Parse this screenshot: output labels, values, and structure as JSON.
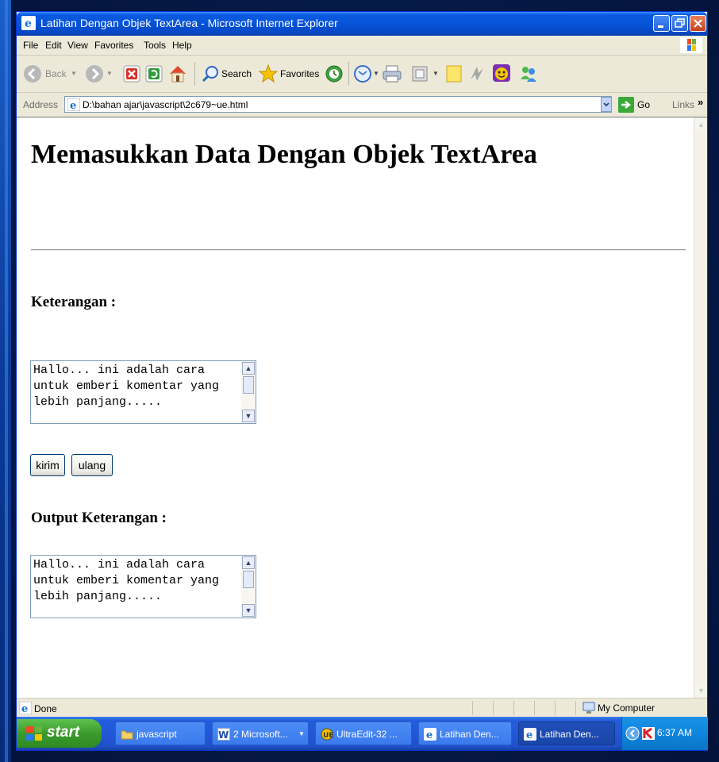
{
  "window": {
    "title": "Latihan Dengan Objek TextArea - Microsoft Internet Explorer"
  },
  "menu": [
    "File",
    "Edit",
    "View",
    "Favorites",
    "Tools",
    "Help"
  ],
  "toolbar": {
    "back_label": "Back",
    "search_label": "Search",
    "favorites_label": "Favorites"
  },
  "address": {
    "label": "Address",
    "url": "D:\\bahan ajar\\javascript\\2c679~ue.html",
    "go_label": "Go",
    "links_label": "Links"
  },
  "page": {
    "heading": "Memasukkan Data Dengan Objek TextArea",
    "keterangan_label": "Keterangan :",
    "input_text": "Hallo... ini adalah cara\nuntuk emberi komentar yang\nlebih panjang.....",
    "submit_label": "kirim",
    "reset_label": "ulang",
    "output_label": "Output Keterangan :",
    "output_text": "Hallo... ini adalah cara\nuntuk emberi komentar yang\nlebih panjang....."
  },
  "status": {
    "text": "Done",
    "zone": "My Computer"
  },
  "taskbar": {
    "start_label": "start",
    "tasks": [
      {
        "label": "javascript"
      },
      {
        "label": "2 Microsoft..."
      },
      {
        "label": "UltraEdit-32 ..."
      },
      {
        "label": "Latihan Den..."
      },
      {
        "label": "Latihan Den..."
      }
    ],
    "clock": "6:37 AM"
  },
  "colors": {
    "titlebar": "#0553d8",
    "taskbar": "#245edc",
    "start_button": "#3b9a2b",
    "slide_background": "#061a48"
  },
  "icons": [
    "ie-icon",
    "minimize-icon",
    "maximize-icon",
    "close-icon",
    "windows-logo-icon",
    "back-arrow-icon",
    "forward-arrow-icon",
    "stop-icon",
    "refresh-icon",
    "home-icon",
    "search-icon",
    "favorites-star-icon",
    "history-icon",
    "mail-icon",
    "print-icon",
    "edit-icon",
    "discuss-icon",
    "messenger-icon",
    "go-arrow-icon",
    "computer-icon",
    "windows-flag-icon",
    "folder-icon",
    "word-icon",
    "ultraedit-icon",
    "kaspersky-icon"
  ]
}
